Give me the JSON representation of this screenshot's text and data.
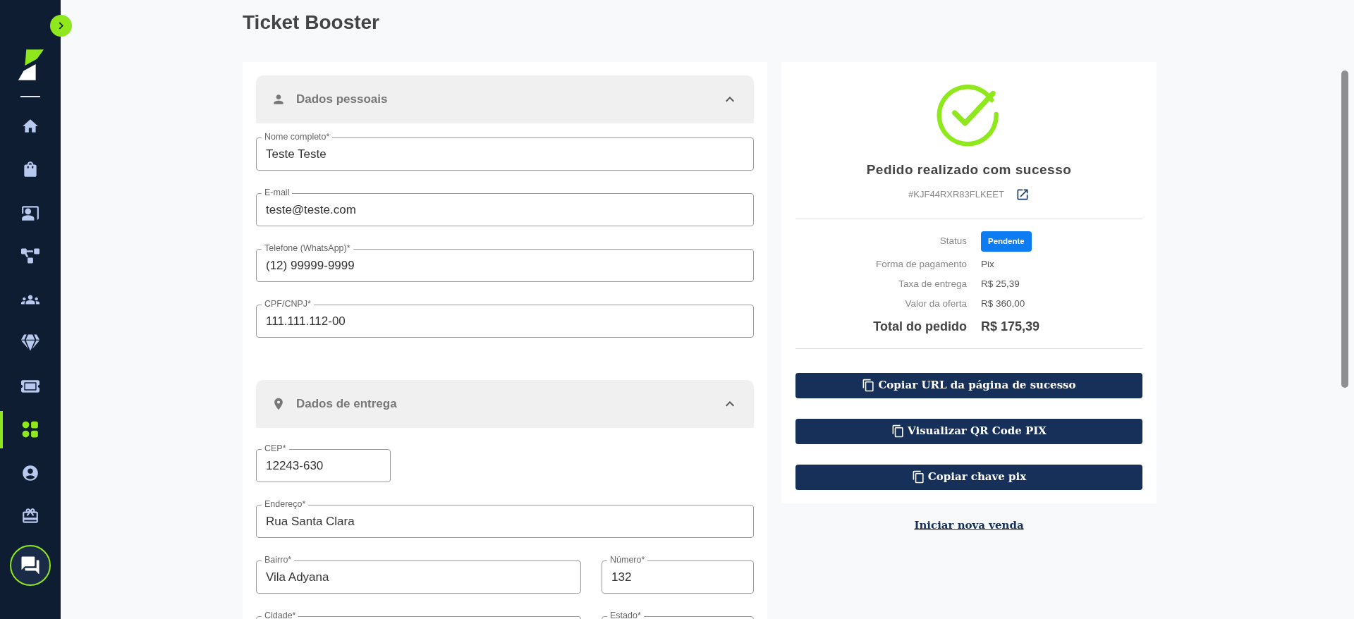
{
  "page": {
    "title": "Ticket Booster"
  },
  "sidebar": {
    "items": [
      {
        "selected": false
      },
      {
        "selected": false
      },
      {
        "selected": false
      },
      {
        "selected": false
      },
      {
        "selected": false
      },
      {
        "selected": false
      },
      {
        "selected": false
      },
      {
        "selected": true
      },
      {
        "selected": false
      },
      {
        "selected": false
      }
    ]
  },
  "sections": [
    {
      "title": "Dados pessoais",
      "expanded": true,
      "rows": [
        [
          {
            "label": "Nome completo*",
            "value": "Teste Teste",
            "kind": "full"
          }
        ],
        [
          {
            "label": "E-mail",
            "value": "teste@teste.com",
            "kind": "full"
          }
        ],
        [
          {
            "label": "Telefone (WhatsApp)*",
            "value": "(12) 99999-9999",
            "kind": "full"
          }
        ],
        [
          {
            "label": "CPF/CNPJ*",
            "value": "111.111.112-00",
            "kind": "full"
          }
        ]
      ]
    },
    {
      "title": "Dados de entrega",
      "expanded": true,
      "rows": [
        [
          {
            "label": "CEP*",
            "value": "12243-630",
            "kind": "short"
          }
        ],
        [
          {
            "label": "Endereço*",
            "value": "Rua Santa Clara",
            "kind": "full"
          }
        ],
        [
          {
            "label": "Bairro*",
            "value": "Vila Adyana",
            "kind": "wide"
          },
          {
            "label": "Número*",
            "value": "132",
            "kind": "narrow"
          }
        ],
        [
          {
            "label": "Cidade*",
            "kind": "wide"
          },
          {
            "label": "Estado*",
            "kind": "narrow"
          }
        ]
      ]
    }
  ],
  "order": {
    "title": "Pedido realizado com sucesso",
    "code": "#KJF44RXR83FLKEET",
    "details": [
      {
        "label": "Status",
        "value": "Pendente",
        "kind": "badge"
      },
      {
        "label": "Forma de pagamento",
        "value": "Pix",
        "kind": "text"
      },
      {
        "label": "Taxa de entrega",
        "value": "R$ 25,39",
        "kind": "text"
      },
      {
        "label": "Valor da oferta",
        "value": "R$ 360,00",
        "kind": "text"
      },
      {
        "label": "Total do pedido",
        "value": "R$ 175,39",
        "kind": "total"
      }
    ],
    "buttons": [
      "Copiar URL da página de sucesso",
      "Visualizar QR Code PIX",
      "Copiar chave pix"
    ],
    "link": "Iniciar nova venda"
  }
}
